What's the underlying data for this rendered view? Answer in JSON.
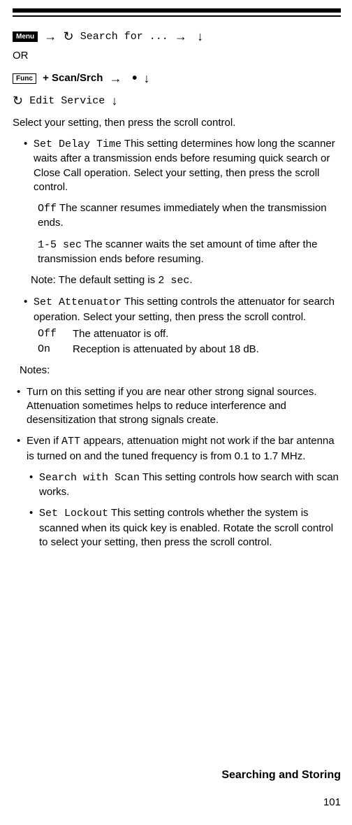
{
  "buttons": {
    "menu": "Menu",
    "func": "Func"
  },
  "nav1_search": "Search for ...",
  "or": "OR",
  "nav2_plus": "+",
  "nav2_scan": "Scan/Srch",
  "nav3_edit": "Edit Service",
  "intro": "Select your setting, then press the scroll control.",
  "item1_label": "Set Delay Time",
  "item1_text": " This setting determines how long the scanner waits after a transmission ends before resuming quick search or Close Call operation. Select your setting, then press the scroll control.",
  "item1_off_label": "Off",
  "item1_off_text": " The scanner resumes immediately when the transmission ends.",
  "item1_sec_label": "1-5 sec",
  "item1_sec_text": " The scanner waits the set amount of time after the transmission ends before resuming.",
  "item1_note_pre": "Note: The default setting is ",
  "item1_note_val": "2 sec",
  "item1_note_post": ".",
  "item2_label": "Set Attenuator",
  "item2_text": " This setting controls the attenuator for search operation. Select your setting, then press the scroll control.",
  "item2_off_label": "Off",
  "item2_off_text": "The attenuator is off.",
  "item2_on_label": "On",
  "item2_on_text": "Reception is attenuated by about 18 dB.",
  "notes_header": "Notes:",
  "note1": "Turn on this setting if you are near other strong signal sources. Attenuation sometimes helps to reduce interference and desensitization that strong signals create.",
  "note2_pre": "Even if ",
  "note2_att": "ATT",
  "note2_post": " appears, attenuation might not work if the bar antenna is turned on and the tuned frequency is from 0.1 to 1.7 MHz.",
  "item3_label": "Search with Scan",
  "item3_text": " This setting controls how search with scan works.",
  "item4_label": "Set Lockout",
  "item4_text": " This setting controls whether the system is scanned when its quick key is enabled. Rotate the scroll control to select your setting, then press the scroll control.",
  "section": "Searching and Storing",
  "pagenum": "101"
}
